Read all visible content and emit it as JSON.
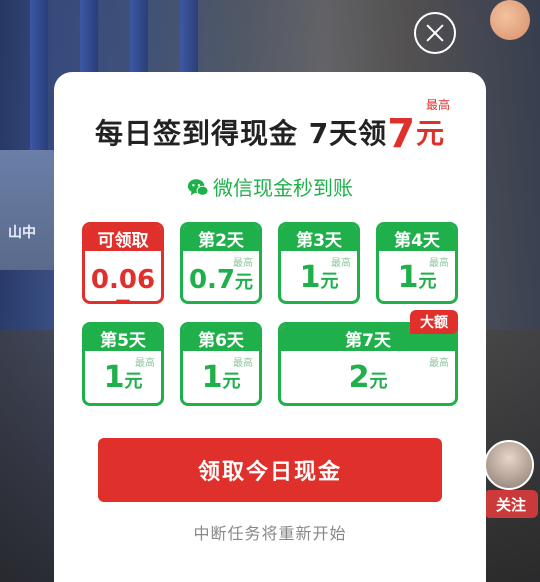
{
  "background": {
    "sign_text": "山中"
  },
  "profile": {
    "follow_label": "关注"
  },
  "modal": {
    "title_prefix": "每日签到得现金 7天领",
    "title_amount": "7",
    "title_unit": "元",
    "title_max": "最高",
    "subtitle": "微信现金秒到账",
    "max_label": "最高",
    "days": [
      {
        "label": "可领取",
        "value": "0.06",
        "unit": "元",
        "state": "available"
      },
      {
        "label": "第2天",
        "value": "0.7",
        "unit": "元",
        "state": "upcoming"
      },
      {
        "label": "第3天",
        "value": "1",
        "unit": "元",
        "state": "upcoming"
      },
      {
        "label": "第4天",
        "value": "1",
        "unit": "元",
        "state": "upcoming"
      },
      {
        "label": "第5天",
        "value": "1",
        "unit": "元",
        "state": "upcoming"
      },
      {
        "label": "第6天",
        "value": "1",
        "unit": "元",
        "state": "upcoming"
      },
      {
        "label": "第7天",
        "value": "2",
        "unit": "元",
        "state": "upcoming"
      }
    ],
    "big_tag": "大额",
    "claim_button": "领取今日现金",
    "note": "中断任务将重新开始"
  },
  "colors": {
    "accent_red": "#e0302b",
    "accent_green": "#1fb04c"
  },
  "icons": {
    "close": "close-icon",
    "wechat": "wechat-icon"
  }
}
